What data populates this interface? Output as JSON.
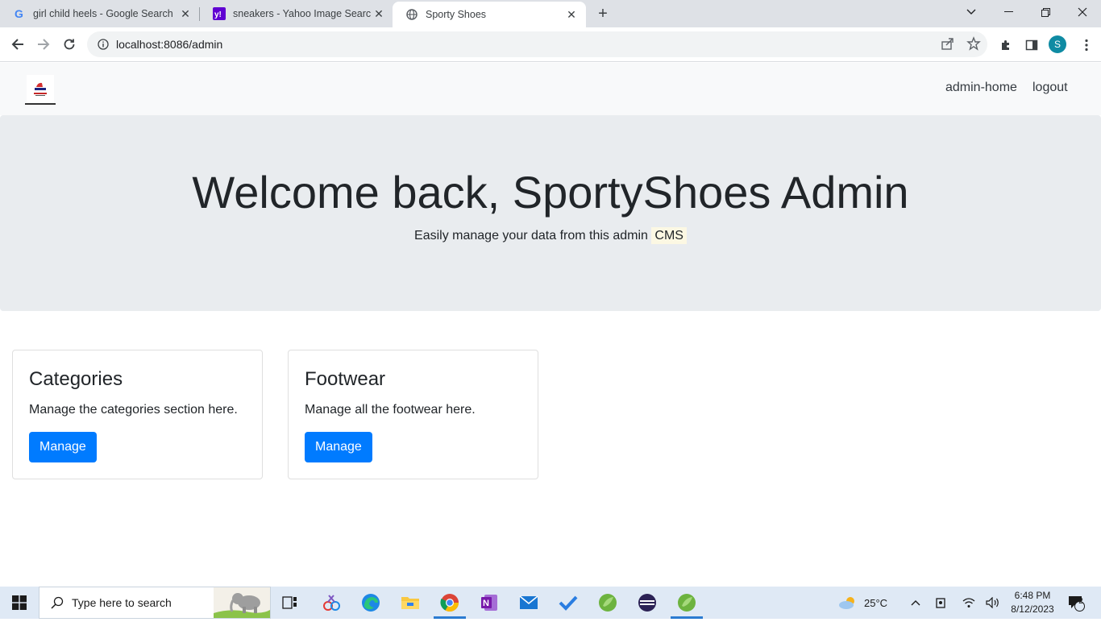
{
  "browser": {
    "tabs": [
      {
        "title": "girl child heels - Google Search",
        "favicon": "google-icon",
        "active": false
      },
      {
        "title": "sneakers - Yahoo Image Search R",
        "favicon": "yahoo-icon",
        "active": false
      },
      {
        "title": "Sporty Shoes",
        "favicon": "globe-icon",
        "active": true
      }
    ],
    "new_tab_label": "+",
    "url": "localhost:8086/admin",
    "profile_initial": "S"
  },
  "page": {
    "nav": {
      "links": [
        "admin-home",
        "logout"
      ]
    },
    "hero": {
      "title": "Welcome back, SportyShoes Admin",
      "lead_text": "Easily manage your data from this admin",
      "lead_mark": "CMS"
    },
    "cards": [
      {
        "title": "Categories",
        "text": "Manage the categories section here.",
        "button": "Manage"
      },
      {
        "title": "Footwear",
        "text": "Manage all the footwear here.",
        "button": "Manage"
      }
    ],
    "colors": {
      "primary": "#007bff",
      "hero_bg": "#e9ecef",
      "navbar_bg": "#f8f9fa"
    }
  },
  "taskbar": {
    "search_placeholder": "Type here to search",
    "weather": "25°C",
    "time": "6:48 PM",
    "date": "8/12/2023",
    "notification_count": "2"
  }
}
